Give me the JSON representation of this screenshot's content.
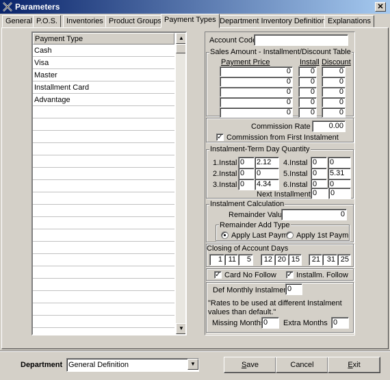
{
  "window": {
    "title": "Parameters",
    "close": "✕"
  },
  "tabs": [
    "General",
    "P.O.S.",
    "Inventories",
    "Product Groups",
    "Payment Types",
    "Department Inventory Definitions",
    "Explanations"
  ],
  "list": {
    "header": "Payment Type",
    "items": [
      "Cash",
      "Visa",
      "Master",
      "Installment Card",
      "Advantage"
    ],
    "scroll_up": "▲",
    "scroll_down": "▼"
  },
  "account_code": {
    "label": "Account Code",
    "value": ""
  },
  "sales_table": {
    "title": "Sales Amount - Installment/Discount Table",
    "col_price": "Payment Price",
    "col_install": "Install",
    "col_discount": "Discount",
    "rows": [
      [
        "0",
        "0",
        "0"
      ],
      [
        "0",
        "0",
        "0"
      ],
      [
        "0",
        "0",
        "0"
      ],
      [
        "0",
        "0",
        "0"
      ],
      [
        "0",
        "0",
        "0"
      ]
    ]
  },
  "commission": {
    "rate_label": "Commission Rate %",
    "rate_value": "0.00",
    "first_label": "Commission from First Instalment",
    "first_checked": "✓"
  },
  "term_days": {
    "title": "Instalment-Term Day Quantity",
    "rows": [
      {
        "label": "1.Instal",
        "a": "0",
        "b": "2.12"
      },
      {
        "label": "2.Instal",
        "a": "0",
        "b": "0"
      },
      {
        "label": "3.Instal",
        "a": "0",
        "b": "4.34"
      },
      {
        "label": "4.Instal",
        "a": "0",
        "b": "0"
      },
      {
        "label": "5.Instal",
        "a": "0",
        "b": "5.31"
      },
      {
        "label": "6.Instal",
        "a": "0",
        "b": "0"
      }
    ],
    "next_label": "Next Installments",
    "next_a": "0",
    "next_b": "0"
  },
  "calc": {
    "title": "Instalment Calculation",
    "remainder_label": "Remainder Value",
    "remainder_value": "0",
    "add_type_title": "Remainder Add Type",
    "opt_last": "Apply Last Paym",
    "opt_first": "Apply 1st Paym"
  },
  "closing": {
    "title": "Closing of Account Days",
    "days": [
      "1",
      "11",
      "5",
      "12",
      "20",
      "15",
      "21",
      "31",
      "25"
    ]
  },
  "follow": {
    "card_label": "Card No Follow",
    "card_checked": "✓",
    "install_label": "Installm. Follow",
    "install_checked": "✓"
  },
  "monthly": {
    "def_label": "Def Monthly Instalment",
    "def_value": "0",
    "note": "\"Rates to be used at different Instalment values than default.\"",
    "missing_label": "Missing Months",
    "missing_value": "0",
    "extra_label": "Extra Months",
    "extra_value": "0"
  },
  "footer": {
    "department_label": "Department",
    "department_value": "General Definition",
    "dropdown_arrow": "▼",
    "save_pre": "",
    "save_u": "S",
    "save_post": "ave",
    "cancel": "Cancel",
    "exit_pre": "",
    "exit_u": "E",
    "exit_post": "xit"
  }
}
